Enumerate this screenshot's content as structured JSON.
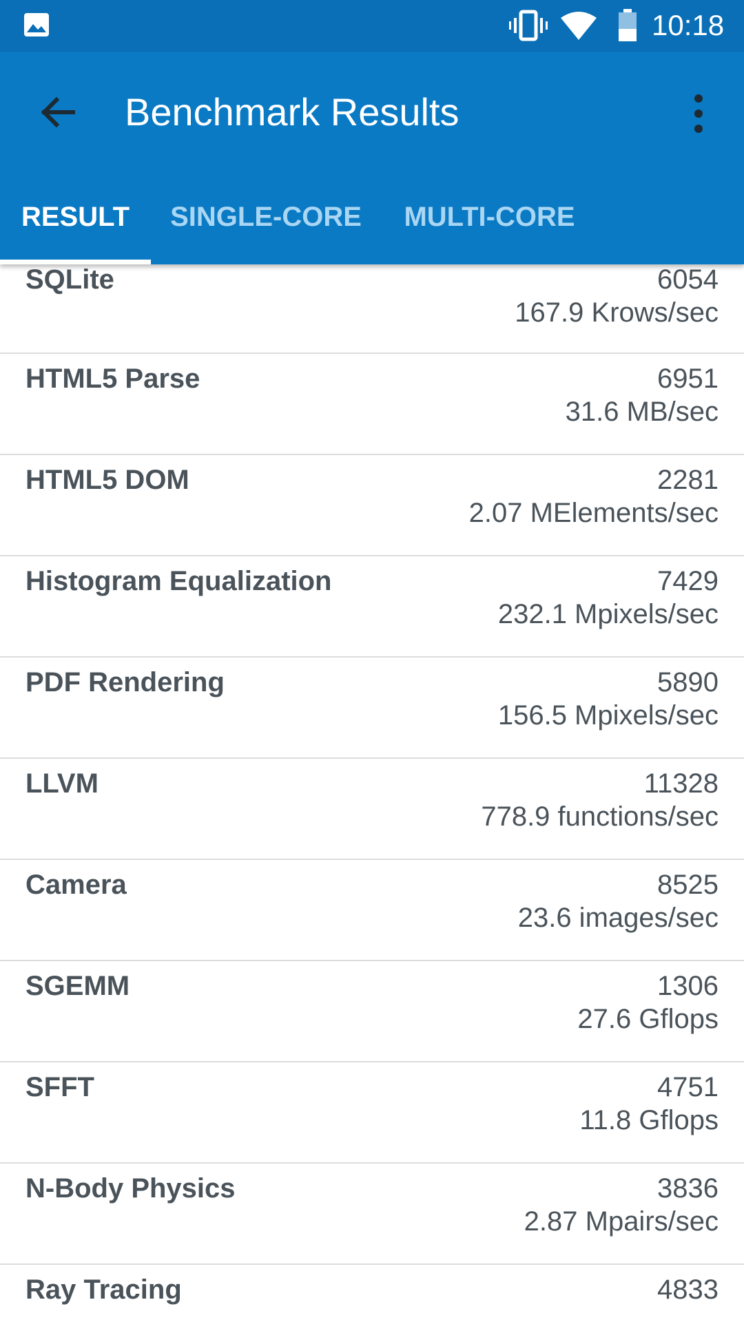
{
  "status_bar": {
    "time": "10:18",
    "icons": [
      "gallery-icon",
      "vibrate-icon",
      "wifi-icon",
      "battery-icon"
    ]
  },
  "app_bar": {
    "title": "Benchmark Results",
    "back_icon": "arrow-left-icon",
    "menu_icon": "more-vert-icon"
  },
  "tabs": [
    {
      "label": "RESULT",
      "active": true
    },
    {
      "label": "SINGLE-CORE",
      "active": false
    },
    {
      "label": "MULTI-CORE",
      "active": false
    }
  ],
  "colors": {
    "status_bar": "#0a6fb6",
    "app_bar": "#0a7ac4",
    "tab_inactive": "#a9d6f3",
    "text": "#4a535a",
    "divider": "#dcdcdc"
  },
  "results": [
    {
      "name": "SQLite",
      "score": "6054",
      "rate": "167.9 Krows/sec"
    },
    {
      "name": "HTML5 Parse",
      "score": "6951",
      "rate": "31.6 MB/sec"
    },
    {
      "name": "HTML5 DOM",
      "score": "2281",
      "rate": "2.07 MElements/sec"
    },
    {
      "name": "Histogram Equalization",
      "score": "7429",
      "rate": "232.1 Mpixels/sec"
    },
    {
      "name": "PDF Rendering",
      "score": "5890",
      "rate": "156.5 Mpixels/sec"
    },
    {
      "name": "LLVM",
      "score": "11328",
      "rate": "778.9 functions/sec"
    },
    {
      "name": "Camera",
      "score": "8525",
      "rate": "23.6 images/sec"
    },
    {
      "name": "SGEMM",
      "score": "1306",
      "rate": "27.6 Gflops"
    },
    {
      "name": "SFFT",
      "score": "4751",
      "rate": "11.8 Gflops"
    },
    {
      "name": "N-Body Physics",
      "score": "3836",
      "rate": "2.87 Mpairs/sec"
    },
    {
      "name": "Ray Tracing",
      "score": "4833",
      "rate": ""
    }
  ]
}
